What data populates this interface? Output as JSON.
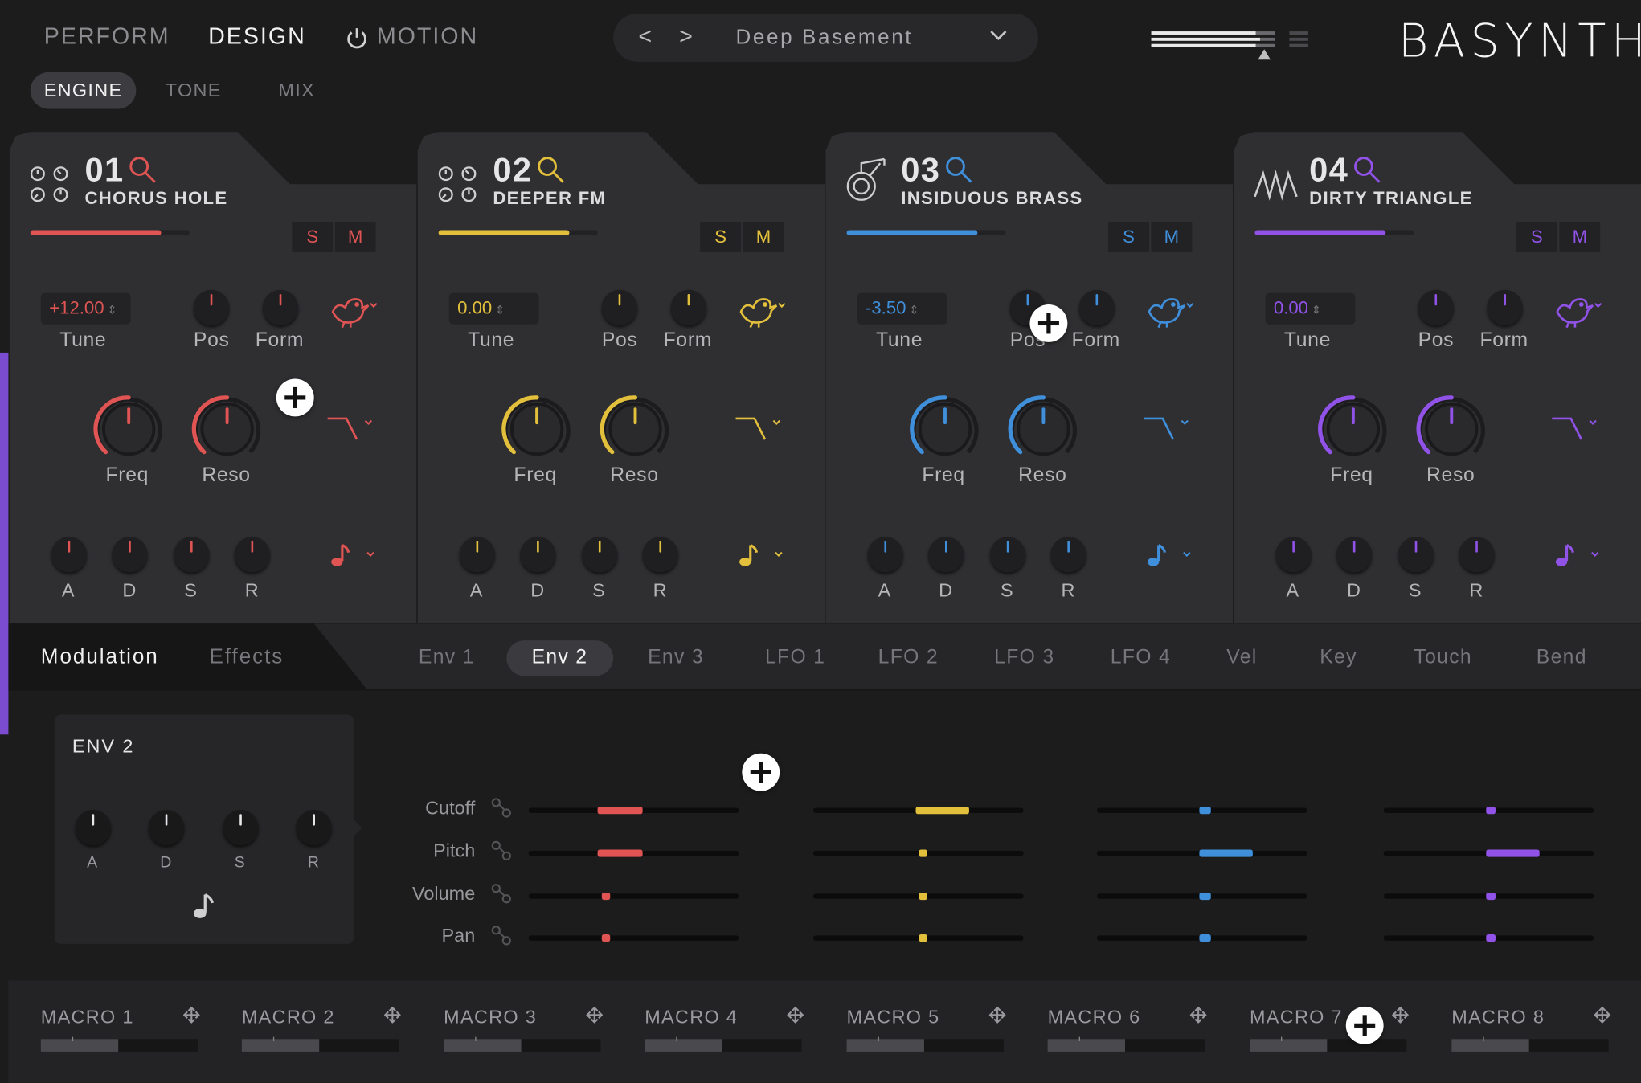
{
  "colors": {
    "osc1": "#e05454",
    "osc2": "#e3c03c",
    "osc3": "#3f8fdb",
    "osc4": "#9152e8"
  },
  "topnav": {
    "perform": "PERFORM",
    "design": "DESIGN",
    "motion": "MOTION"
  },
  "subnav": {
    "engine": "ENGINE",
    "tone": "TONE",
    "mix": "MIX"
  },
  "preset": {
    "arrows": "< >",
    "name": "Deep Basement"
  },
  "logo": "BASYNTH",
  "panels": [
    {
      "num": "01",
      "name": "CHORUS HOLE",
      "tune": "+12.00",
      "level": 0.82,
      "s": "S",
      "m": "M",
      "tune_label": "Tune",
      "pos_label": "Pos",
      "form_label": "Form",
      "freq_label": "Freq",
      "reso_label": "Reso",
      "a": "A",
      "d": "D",
      "s_env": "S",
      "r": "R"
    },
    {
      "num": "02",
      "name": "DEEPER FM",
      "tune": "0.00",
      "level": 0.82,
      "s": "S",
      "m": "M",
      "tune_label": "Tune",
      "pos_label": "Pos",
      "form_label": "Form",
      "freq_label": "Freq",
      "reso_label": "Reso",
      "a": "A",
      "d": "D",
      "s_env": "S",
      "r": "R"
    },
    {
      "num": "03",
      "name": "INSIDUOUS BRASS",
      "tune": "-3.50",
      "level": 0.82,
      "s": "S",
      "m": "M",
      "tune_label": "Tune",
      "pos_label": "Pos",
      "form_label": "Form",
      "freq_label": "Freq",
      "reso_label": "Reso",
      "a": "A",
      "d": "D",
      "s_env": "S",
      "r": "R"
    },
    {
      "num": "04",
      "name": "DIRTY TRIANGLE",
      "tune": "0.00",
      "level": 0.82,
      "s": "S",
      "m": "M",
      "tune_label": "Tune",
      "pos_label": "Pos",
      "form_label": "Form",
      "freq_label": "Freq",
      "reso_label": "Reso",
      "a": "A",
      "d": "D",
      "s_env": "S",
      "r": "R"
    }
  ],
  "mod": {
    "tabs": [
      "Modulation",
      "Effects"
    ],
    "sources": [
      "Env 1",
      "Env 2",
      "Env 3",
      "LFO 1",
      "LFO 2",
      "LFO 3",
      "LFO 4",
      "Vel",
      "Key",
      "Touch",
      "Bend"
    ],
    "active_source": "Env 2",
    "env_title": "ENV 2",
    "env_labels": [
      "A",
      "D",
      "S",
      "R"
    ],
    "destinations": [
      "Cutoff",
      "Pitch",
      "Volume",
      "Pan"
    ]
  },
  "macros": [
    "MACRO 1",
    "MACRO 2",
    "MACRO 3",
    "MACRO 4",
    "MACRO 5",
    "MACRO 6",
    "MACRO 7",
    "MACRO 8"
  ]
}
